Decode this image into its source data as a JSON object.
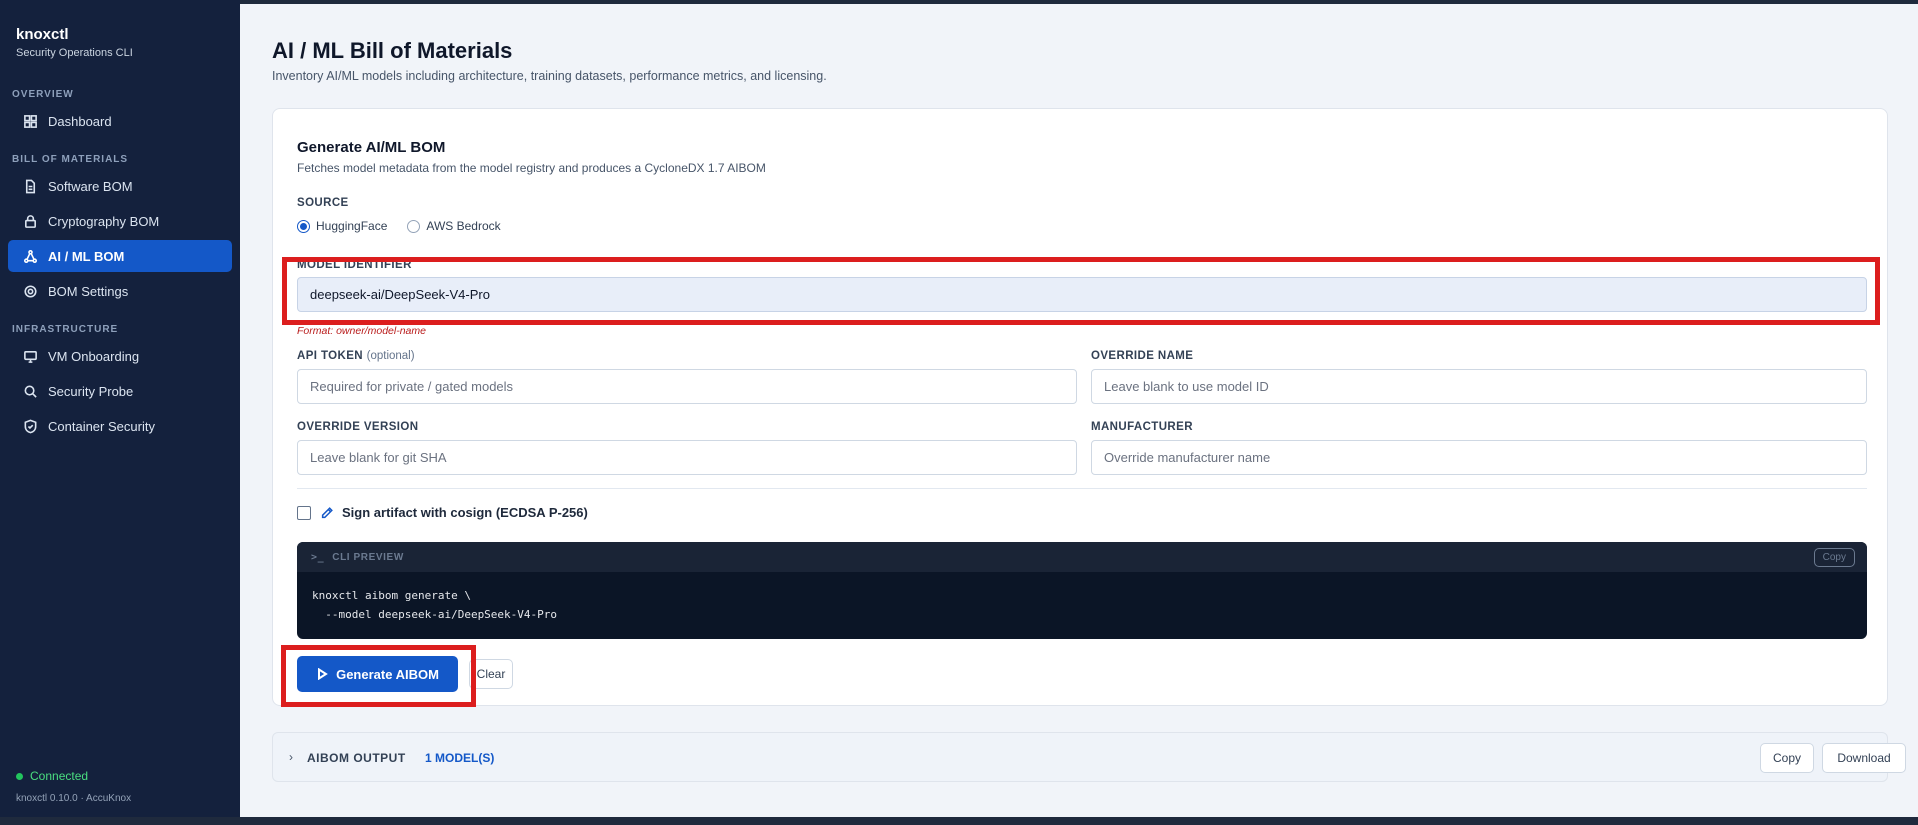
{
  "sidebar": {
    "brand": "knoxctl",
    "brand_sub": "Security Operations CLI",
    "sections": {
      "overview": "OVERVIEW",
      "bom": "BILL OF MATERIALS",
      "infra": "INFRASTRUCTURE"
    },
    "items": {
      "dashboard": "Dashboard",
      "software_bom": "Software BOM",
      "crypto_bom": "Cryptography BOM",
      "aiml_bom": "AI / ML BOM",
      "bom_settings": "BOM Settings",
      "vm_onboarding": "VM Onboarding",
      "security_probe": "Security Probe",
      "container_security": "Container Security"
    },
    "status": "Connected",
    "version": "knoxctl 0.10.0 · AccuKnox"
  },
  "page": {
    "title": "AI / ML Bill of Materials",
    "description": "Inventory AI/ML models including architecture, training datasets, performance metrics, and licensing."
  },
  "form": {
    "title": "Generate AI/ML BOM",
    "description": "Fetches model metadata from the model registry and produces a CycloneDX 1.7 AIBOM",
    "source_label": "SOURCE",
    "source_options": [
      "HuggingFace",
      "AWS Bedrock"
    ],
    "source_selected": "HuggingFace",
    "model_label": "MODEL IDENTIFIER",
    "model_value": "deepseek-ai/DeepSeek-V4-Pro",
    "model_hint": "Format: owner/model-name",
    "api_token_label": "API TOKEN",
    "api_token_optional": "(optional)",
    "api_token_placeholder": "Required for private / gated models",
    "override_name_label": "OVERRIDE NAME",
    "override_name_placeholder": "Leave blank to use model ID",
    "override_version_label": "OVERRIDE VERSION",
    "override_version_placeholder": "Leave blank for git SHA",
    "manufacturer_label": "MANUFACTURER",
    "manufacturer_placeholder": "Override manufacturer name",
    "sign_label": "Sign artifact with cosign (ECDSA P-256)",
    "cli_title": "CLI PREVIEW",
    "cli_copy": "Copy",
    "cli_command": "knoxctl aibom generate \\\n  --model deepseek-ai/DeepSeek-V4-Pro",
    "generate_label": "Generate AIBOM",
    "clear_label": "Clear"
  },
  "output": {
    "label": "AIBOM OUTPUT",
    "count": "1 MODEL(S)",
    "copy_label": "Copy",
    "download_label": "Download"
  },
  "colors": {
    "sidebar_bg": "#14213d",
    "accent": "#1458c8",
    "highlight": "#dc1e1e",
    "connected": "#22c55e"
  }
}
